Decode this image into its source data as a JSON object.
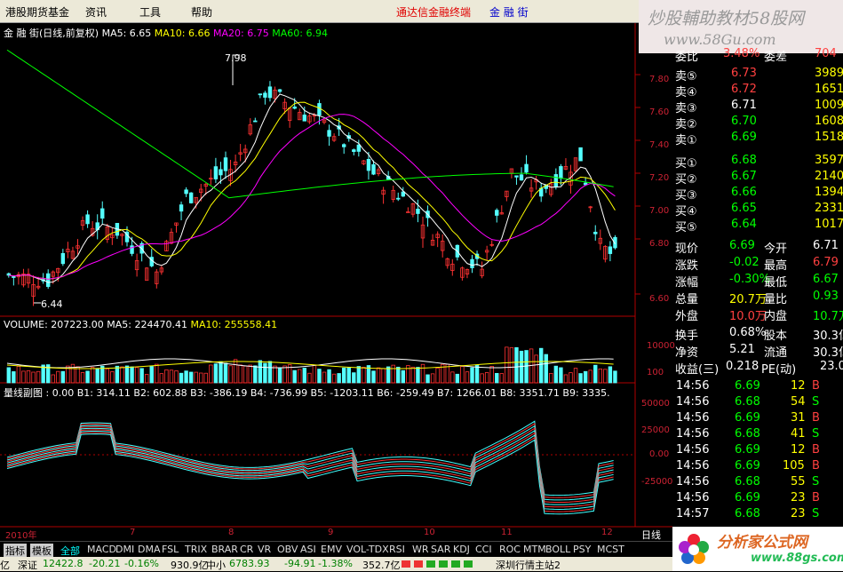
{
  "menu": {
    "items": [
      "港股期货基金",
      "资讯",
      "工具",
      "帮助"
    ],
    "app_title": "通达信金融终端",
    "stock_name": "金 融 街"
  },
  "watermark": {
    "line1": "炒股輔助教材58股网",
    "line2": "www.58Gu.com"
  },
  "price_panel": {
    "header": [
      {
        "t": "金 融 街(日线,前复权)",
        "c": "#ffffff"
      },
      {
        "t": "MA5: 6.65",
        "c": "#ffffff"
      },
      {
        "t": "MA10: 6.66",
        "c": "#ffff00"
      },
      {
        "t": "MA20: 6.75",
        "c": "#ff00ff"
      },
      {
        "t": "MA60: 6.94",
        "c": "#00ff00"
      }
    ],
    "y_ticks": [
      "7.80",
      "7.60",
      "7.40",
      "7.20",
      "7.00",
      "6.80",
      "6.60"
    ],
    "high_label": "7.98",
    "low_label": "6.44"
  },
  "volume_panel": {
    "header": [
      {
        "t": "VOLUME: 207223.00",
        "c": "#ffffff"
      },
      {
        "t": "MA5: 224470.41",
        "c": "#ffffff"
      },
      {
        "t": "MA10: 255558.41",
        "c": "#ffff00"
      }
    ],
    "y_ticks": [
      "10000",
      "100"
    ]
  },
  "indicator_panel": {
    "header": "量线副图 : 0.00  B1: 314.11  B2: 602.88  B3: -386.19  B4: -736.99  B5: -1203.11  B6: -259.49  B7: 1266.01  B8: 3351.71  B9: 3335.",
    "y_ticks": [
      "50000",
      "25000",
      "0.00",
      "-25000"
    ]
  },
  "x_axis": {
    "labels": [
      "2010年",
      "7",
      "8",
      "9",
      "10",
      "11",
      "12"
    ],
    "period": "日线"
  },
  "quote": {
    "ratio": {
      "label": "委比",
      "value": "3.48%",
      "diff_label": "委差",
      "diff": "704"
    },
    "asks": [
      {
        "label": "卖⑤",
        "price": "6.73",
        "vol": "3989"
      },
      {
        "label": "卖④",
        "price": "6.72",
        "vol": "1651"
      },
      {
        "label": "卖③",
        "price": "6.71",
        "vol": "1009"
      },
      {
        "label": "卖②",
        "price": "6.70",
        "vol": "1608"
      },
      {
        "label": "卖①",
        "price": "6.69",
        "vol": "1518"
      }
    ],
    "bids": [
      {
        "label": "买①",
        "price": "6.68",
        "vol": "3597"
      },
      {
        "label": "买②",
        "price": "6.67",
        "vol": "2140"
      },
      {
        "label": "买③",
        "price": "6.66",
        "vol": "1394"
      },
      {
        "label": "买④",
        "price": "6.65",
        "vol": "2331"
      },
      {
        "label": "买⑤",
        "price": "6.64",
        "vol": "1017"
      }
    ],
    "stats": [
      {
        "l1": "现价",
        "v1": "6.69",
        "c1": "#00ff00",
        "l2": "今开",
        "v2": "6.71",
        "c2": "#ffffff"
      },
      {
        "l1": "涨跌",
        "v1": "-0.02",
        "c1": "#00ff00",
        "l2": "最高",
        "v2": "6.79",
        "c2": "#ff4040"
      },
      {
        "l1": "涨幅",
        "v1": "-0.30%",
        "c1": "#00ff00",
        "l2": "最低",
        "v2": "6.67",
        "c2": "#00ff00"
      },
      {
        "l1": "总量",
        "v1": "20.7万",
        "c1": "#ffff00",
        "l2": "量比",
        "v2": "0.93",
        "c2": "#00ff00"
      },
      {
        "l1": "外盘",
        "v1": "10.0万",
        "c1": "#ff4040",
        "l2": "内盘",
        "v2": "10.7万",
        "c2": "#00ff00"
      },
      {
        "l1": "换手",
        "v1": "0.68%",
        "c1": "#ffffff",
        "l2": "股本",
        "v2": "30.3亿",
        "c2": "#ffffff"
      },
      {
        "l1": "净资",
        "v1": "5.21",
        "c1": "#ffffff",
        "l2": "流通",
        "v2": "30.3亿",
        "c2": "#ffffff"
      },
      {
        "l1": "收益(三)",
        "v1": "0.218",
        "c1": "#ffffff",
        "l2": "PE(动)",
        "v2": "23.0",
        "c2": "#ffffff"
      }
    ]
  },
  "ticks": [
    {
      "time": "14:56",
      "price": "6.69",
      "vol": "12",
      "bs": "B"
    },
    {
      "time": "14:56",
      "price": "6.68",
      "vol": "54",
      "bs": "S"
    },
    {
      "time": "14:56",
      "price": "6.69",
      "vol": "31",
      "bs": "B"
    },
    {
      "time": "14:56",
      "price": "6.68",
      "vol": "41",
      "bs": "S"
    },
    {
      "time": "14:56",
      "price": "6.69",
      "vol": "12",
      "bs": "B"
    },
    {
      "time": "14:56",
      "price": "6.69",
      "vol": "105",
      "bs": "B"
    },
    {
      "time": "14:56",
      "price": "6.68",
      "vol": "55",
      "bs": "S"
    },
    {
      "time": "14:56",
      "price": "6.69",
      "vol": "23",
      "bs": "B"
    },
    {
      "time": "14:57",
      "price": "6.68",
      "vol": "23",
      "bs": "S"
    }
  ],
  "tabs": [
    "指标",
    "模板",
    "全部",
    "MACD",
    "DMI",
    "DMA",
    "FSL",
    "TRIX",
    "BRAR",
    "CR",
    "VR",
    "OBV",
    "ASI",
    "EMV",
    "VOL-TDX",
    "RSI",
    "WR",
    "SAR",
    "KDJ",
    "CCI",
    "ROC",
    "MTM",
    "BOLL",
    "PSY",
    "MCST"
  ],
  "status_bar": [
    {
      "t": "亿",
      "c": "#000"
    },
    {
      "t": "深证",
      "c": "#000"
    },
    {
      "t": "12422.8",
      "c": "#008000"
    },
    {
      "t": "-20.21",
      "c": "#008000"
    },
    {
      "t": "-0.16%",
      "c": "#008000"
    },
    {
      "t": "930.9亿",
      "c": "#000"
    },
    {
      "t": "中小",
      "c": "#000"
    },
    {
      "t": "6783.93",
      "c": "#008000"
    },
    {
      "t": "-94.91",
      "c": "#008000"
    },
    {
      "t": "-1.38%",
      "c": "#008000"
    },
    {
      "t": "352.7亿",
      "c": "#000"
    },
    {
      "t": "深圳行情主站2",
      "c": "#000"
    }
  ],
  "logo": {
    "name": "分析家公式网",
    "url": "www.88gs.com"
  },
  "colors": {
    "up": "#ff3232",
    "down": "#54ffff",
    "ma5": "#ffffff",
    "ma10": "#ffff00",
    "ma20": "#ff00ff",
    "ma60": "#00ff00",
    "axis": "#b00000"
  }
}
